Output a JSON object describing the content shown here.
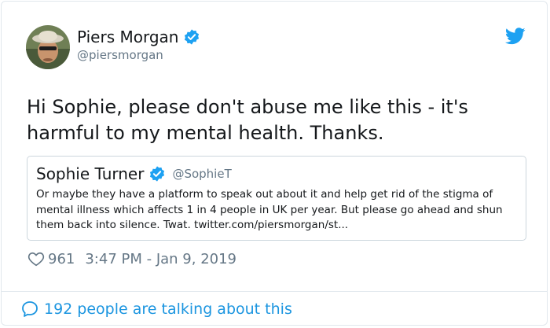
{
  "author": {
    "name": "Piers Morgan",
    "handle": "@piersmorgan",
    "verified": true
  },
  "tweet": {
    "text": "Hi Sophie, please don't abuse me like this - it's\nharmful to my mental health. Thanks."
  },
  "quoted_tweet": {
    "name": "Sophie Turner",
    "handle": "@SophieT",
    "verified": true,
    "text": "Or maybe they have a platform to speak out about it and help get rid of the stigma of mental illness which affects 1 in 4 people in UK per year. But please go ahead and shun them back into silence. Twat. twitter.com/piersmorgan/st..."
  },
  "meta": {
    "likes": "961",
    "timestamp": "3:47 PM - Jan 9, 2019"
  },
  "footer": {
    "talking": "192 people are talking about this"
  },
  "colors": {
    "link_blue": "#1b95e0",
    "verified_blue": "#1da1f2",
    "muted": "#657786",
    "border": "#e1e8ed"
  },
  "icons": {
    "logo": "twitter-bird-icon",
    "verified": "verified-badge-icon",
    "like": "heart-icon",
    "reply": "speech-bubble-icon"
  }
}
